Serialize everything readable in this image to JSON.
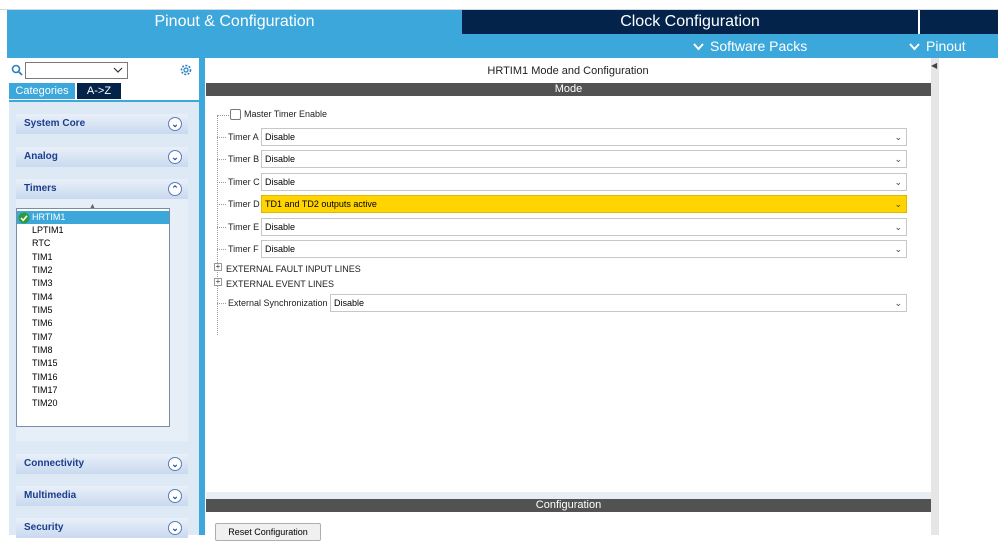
{
  "tabs": {
    "pinout_config": "Pinout & Configuration",
    "clock_config": "Clock Configuration"
  },
  "submenu": {
    "software_packs": "Software Packs",
    "pinout": "Pinout"
  },
  "left": {
    "search_value": "",
    "view_tabs": [
      "Categories",
      "A->Z"
    ],
    "categories": {
      "system_core": "System Core",
      "analog": "Analog",
      "timers": "Timers",
      "connectivity": "Connectivity",
      "multimedia": "Multimedia",
      "security": "Security"
    },
    "timers_items": [
      "HRTIM1",
      "LPTIM1",
      "RTC",
      "TIM1",
      "TIM2",
      "TIM3",
      "TIM4",
      "TIM5",
      "TIM6",
      "TIM7",
      "TIM8",
      "TIM15",
      "TIM16",
      "TIM17",
      "TIM20"
    ],
    "selected_timer": "HRTIM1"
  },
  "main": {
    "title": "HRTIM1 Mode and Configuration",
    "mode_header": "Mode",
    "config_header": "Configuration",
    "master_timer_label": "Master Timer Enable",
    "master_timer_checked": false,
    "timers": [
      {
        "label": "Timer A",
        "value": "Disable"
      },
      {
        "label": "Timer B",
        "value": "Disable"
      },
      {
        "label": "Timer C",
        "value": "Disable"
      },
      {
        "label": "Timer D",
        "value": "TD1 and TD2 outputs active"
      },
      {
        "label": "Timer E",
        "value": "Disable"
      },
      {
        "label": "Timer F",
        "value": "Disable"
      }
    ],
    "fault_lines": "EXTERNAL FAULT INPUT LINES",
    "event_lines": "EXTERNAL EVENT LINES",
    "ext_sync_label": "External Synchronization",
    "ext_sync_value": "Disable",
    "reset_button": "Reset Configuration"
  },
  "colors": {
    "accent": "#3ba7db",
    "navy": "#03234b",
    "highlight": "#ffd400"
  }
}
